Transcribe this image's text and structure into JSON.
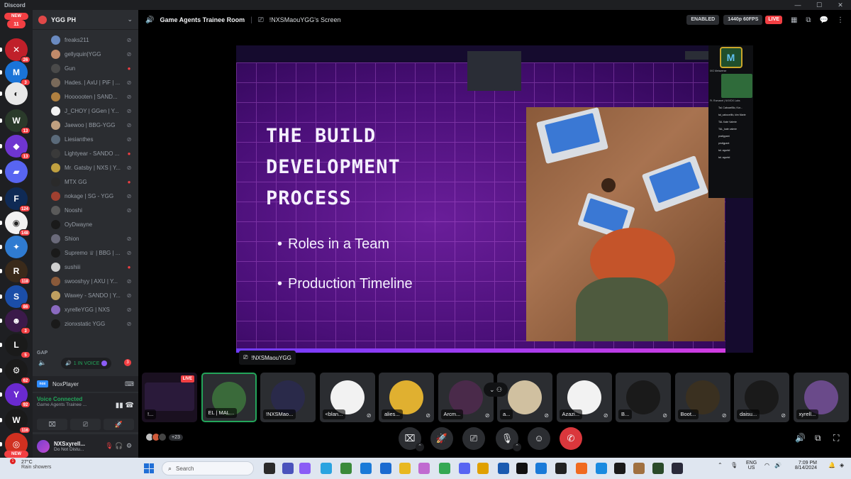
{
  "window": {
    "title": "Discord"
  },
  "rail": {
    "servers": [
      {
        "top": "new",
        "label": "NEW",
        "badge": "11",
        "color": "#f23f43",
        "glyph": ""
      },
      {
        "label": "",
        "badge": "26",
        "color": "#c0202a",
        "glyph": "✕"
      },
      {
        "label": "",
        "badge": "3",
        "color": "#1a74d8",
        "glyph": "M"
      },
      {
        "label": "",
        "badge": "",
        "color": "#e8e8e8",
        "glyph": "◐"
      },
      {
        "label": "",
        "badge": "13",
        "color": "#2a3a2a",
        "glyph": "W"
      },
      {
        "label": "",
        "badge": "13",
        "color": "#6f35d0",
        "glyph": "◆"
      },
      {
        "label": "",
        "badge": "",
        "color": "#5865f2",
        "glyph": "▰"
      },
      {
        "label": "",
        "badge": "124",
        "color": "#0f2a55",
        "glyph": "F"
      },
      {
        "label": "",
        "badge": "148",
        "color": "#f2f2f2",
        "glyph": "◉"
      },
      {
        "label": "",
        "badge": "",
        "color": "#2f7bd1",
        "glyph": "✦"
      },
      {
        "label": "",
        "badge": "118",
        "color": "#3a2a1a",
        "glyph": "R"
      },
      {
        "label": "",
        "badge": "86",
        "color": "#1b4ea8",
        "glyph": "S"
      },
      {
        "label": "",
        "badge": "3",
        "color": "#3b1a4a",
        "glyph": "☻"
      },
      {
        "label": "",
        "badge": "5",
        "color": "#1a1a1a",
        "glyph": "L"
      },
      {
        "label": "",
        "badge": "62",
        "color": "#1a1a1a",
        "glyph": "⚙"
      },
      {
        "label": "",
        "badge": "92",
        "color": "#6a2ad0",
        "glyph": "Y"
      },
      {
        "label": "",
        "badge": "116",
        "color": "#1a1a1a",
        "glyph": "W"
      },
      {
        "label": "NEW",
        "badge": "",
        "color": "#d03020",
        "glyph": "◎"
      }
    ]
  },
  "sidebar": {
    "server_name": "YGG PH",
    "voice_users": [
      {
        "name": "freaks211",
        "status": "deaf",
        "color": "#6a8ac0"
      },
      {
        "name": "gellyquin|YGG",
        "status": "deaf",
        "color": "#c08a6a"
      },
      {
        "name": "Gun",
        "status": "live",
        "color": "#4a4a4a"
      },
      {
        "name": "Hades. | AxU | PiF | ...",
        "status": "deaf",
        "color": "#7a6a5a"
      },
      {
        "name": "Hoooooten | SAND...",
        "status": "deaf",
        "color": "#b08040"
      },
      {
        "name": "J_CHOY | GGen | Y...",
        "status": "deaf",
        "color": "#f2f2f2"
      },
      {
        "name": "Jaewoo | BBG-YGG",
        "status": "deaf",
        "color": "#c0a080"
      },
      {
        "name": "Liesianthes",
        "status": "deaf",
        "color": "#5a6a7a"
      },
      {
        "name": "Lightyear - SANDO ...",
        "status": "live",
        "color": "#3a3a3a"
      },
      {
        "name": "Mr. Gatsby | NXS | Y...",
        "status": "deaf",
        "color": "#c0a040"
      },
      {
        "name": "MTX GG",
        "status": "live",
        "color": "#2a2a2a"
      },
      {
        "name": "nokage | SG - YGG",
        "status": "deaf",
        "color": "#a04030"
      },
      {
        "name": "Nooshi",
        "status": "deaf",
        "color": "#5a5a5a"
      },
      {
        "name": "OyDwayne",
        "status": "",
        "color": "#1a1a1a"
      },
      {
        "name": "Shion",
        "status": "deaf",
        "color": "#6a6a7a"
      },
      {
        "name": "Supremo ♕ | BBG | ...",
        "status": "deaf",
        "color": "#1a1a1a"
      },
      {
        "name": "sushiii",
        "status": "live",
        "color": "#d0d0d0"
      },
      {
        "name": "swooshyy | AXU | Y...",
        "status": "deaf",
        "color": "#8a5a3a"
      },
      {
        "name": "Wawey - SANDO | Y...",
        "status": "deaf",
        "color": "#c0a060"
      },
      {
        "name": "xyrelleYGG | NXS",
        "status": "deaf",
        "color": "#8a6ac0"
      },
      {
        "name": "zionxstatic YGG",
        "status": "deaf",
        "color": "#1a1a1a"
      }
    ],
    "category": "GAP",
    "gap_badge": "3",
    "in_voice": "1 IN VOICE",
    "activity": {
      "name": "NoxPlayer",
      "logo": "nox"
    },
    "voice": {
      "title": "Voice Connected",
      "channel": "Game Agents Trainee ..."
    },
    "user": {
      "name": "NXSxyrell...",
      "status": "Do Not Distu..."
    }
  },
  "topbar": {
    "room": "Game Agents Trainee Room",
    "screen": "!NXSMaouYGG's Screen",
    "enabled": "ENABLED",
    "quality": "1440p 60FPS",
    "live": "LIVE"
  },
  "stream": {
    "slide_title_lines": [
      "THE BUILD",
      "DEVELOPMENT",
      "PROCESS"
    ],
    "bullets": [
      "Roles in a Team",
      "Production Timeline"
    ],
    "streamer": "!NXSMaouYGG",
    "cam_logo": "M",
    "cam_labels": [
      "IXG Metaverse",
      "Ft. Romanel | NXVDX Labs",
      "Tal. CaboceBlo, Kor...",
      "tal_cabocellfo, kim Marie",
      "TAL Kate Valerie",
      "TAL_kate valerie",
      "pratlgpant",
      "prstlgpant",
      "tal. aguntd",
      "tal. aguntd"
    ]
  },
  "participants": [
    {
      "label": "!...",
      "live": "LIVE",
      "color": "#2a1a3a",
      "muted": false
    },
    {
      "label": "EL | MAL...",
      "live": "",
      "color": "#3a6a3a",
      "muted": false
    },
    {
      "label": "!NXSMao...",
      "live": "",
      "color": "#2a2a4a",
      "muted": false
    },
    {
      "label": "<blan...",
      "live": "",
      "color": "#f2f2f2",
      "muted": true
    },
    {
      "label": "alies...",
      "live": "",
      "color": "#e0b030",
      "muted": true
    },
    {
      "label": "Arcm...",
      "live": "",
      "color": "#4a2a4a",
      "muted": true
    },
    {
      "label": "a...",
      "live": "",
      "color": "#d0c0a0",
      "muted": true
    },
    {
      "label": "Azazi...",
      "live": "",
      "color": "#f2f2f2",
      "muted": true
    },
    {
      "label": "B...",
      "live": "",
      "color": "#1a1a1a",
      "muted": true
    },
    {
      "label": "Boot...",
      "live": "",
      "color": "#3a3020",
      "muted": true
    },
    {
      "label": "daisu...",
      "live": "",
      "color": "#1a1a1a",
      "muted": true
    },
    {
      "label": "xyrell...",
      "live": "",
      "color": "#6a4a8a",
      "muted": false
    }
  ],
  "controls": {
    "extra_count": "+23"
  },
  "taskbar": {
    "temp": "27°C",
    "weather": "Rain showers",
    "weather_badge": "1",
    "search_placeholder": "Search",
    "lang_top": "ENG",
    "lang_bottom": "US",
    "time": "7:09 PM",
    "date": "8/14/2024"
  }
}
